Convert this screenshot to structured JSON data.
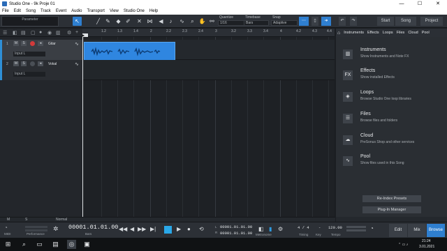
{
  "window": {
    "title": "Studio One - 9k Proje 01",
    "controls": [
      "—",
      "☐",
      "✕"
    ]
  },
  "menu": [
    "File",
    "Edit",
    "Song",
    "Track",
    "Event",
    "Audio",
    "Transport",
    "View",
    "Studio One",
    "Help"
  ],
  "toolbar": {
    "parameter_label": "Parameter",
    "quantize": {
      "label": "Quantize",
      "value": "1/16"
    },
    "timebase": {
      "label": "Timebase",
      "value": "Bars"
    },
    "snap": {
      "label": "Snap",
      "value": "Adaptive"
    },
    "start_label": "Start",
    "song_label": "Song",
    "project_label": "Project"
  },
  "tracks": [
    {
      "number": "1",
      "name": "Gitar",
      "input": "Input L",
      "m": "M",
      "s": "S",
      "armed": true
    },
    {
      "number": "2",
      "name": "Vokal",
      "input": "Input L",
      "m": "M",
      "s": "S",
      "armed": false
    }
  ],
  "ruler_ticks": [
    "1.2",
    "1.3",
    "1.4",
    "2",
    "2.2",
    "2.3",
    "2.4",
    "3",
    "3.2",
    "3.3",
    "3.4",
    "4",
    "4.2",
    "4.3",
    "4.4"
  ],
  "browser": {
    "tabs": [
      "Instruments",
      "Effects",
      "Loops",
      "Files",
      "Cloud",
      "Pool"
    ],
    "items": [
      {
        "icon": "instruments-icon",
        "glyph": "▥",
        "title": "Instruments",
        "desc": "Show Instruments and Note FX"
      },
      {
        "icon": "effects-icon",
        "glyph": "FX",
        "title": "Effects",
        "desc": "Show installed Effects"
      },
      {
        "icon": "loops-icon",
        "glyph": "◈",
        "title": "Loops",
        "desc": "Browse Studio One loop libraries"
      },
      {
        "icon": "files-icon",
        "glyph": "☰",
        "title": "Files",
        "desc": "Browse files and folders"
      },
      {
        "icon": "cloud-icon",
        "glyph": "☁",
        "title": "Cloud",
        "desc": "PreSonus Shop and other services"
      },
      {
        "icon": "pool-icon",
        "glyph": "∿",
        "title": "Pool",
        "desc": "Show files used in this Song"
      }
    ],
    "reindex_label": "Re-Index Presets",
    "plugin_manager_label": "Plug-In Manager"
  },
  "bottom_strip": {
    "m": "M",
    "s": "S",
    "mode": "Normal"
  },
  "transport": {
    "midi_label": "MIDI",
    "performance_label": "Performance",
    "position": "00001.01.01.00",
    "position_unit": "Bars",
    "loop_start": "00001.01.01.00",
    "loop_end": "00001.01.01.00",
    "loop_start_label": "L",
    "loop_end_label": "R",
    "metronome_label": "Metronome",
    "timing_value": "4 / 4",
    "timing_label": "Timing",
    "key_label": "Key",
    "key_value": "-",
    "tempo_value": "120.00",
    "tempo_label": "Tempo",
    "modes": [
      "Edit",
      "Mix",
      "Browse"
    ]
  },
  "taskbar": {
    "time": "21:24",
    "date": "3.01.2021"
  }
}
